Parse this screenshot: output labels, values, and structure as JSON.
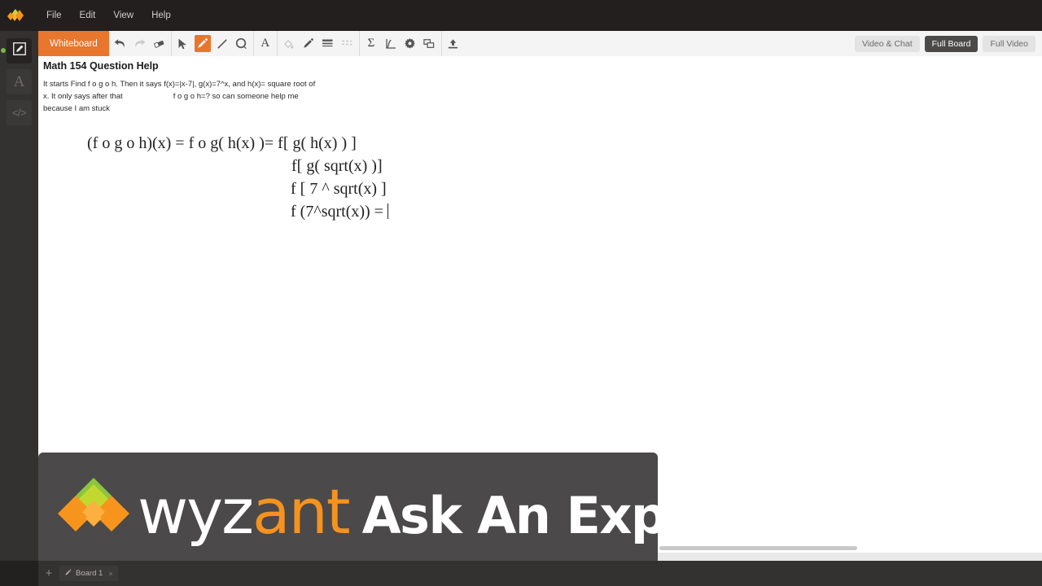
{
  "menubar": {
    "logo_icon": "wyzant-diamond-logo",
    "items": [
      {
        "label": "File"
      },
      {
        "label": "Edit"
      },
      {
        "label": "View"
      },
      {
        "label": "Help"
      }
    ]
  },
  "rail": {
    "items": [
      {
        "name": "whiteboard",
        "icon": "pencil-square-icon",
        "state": "active",
        "has_status_dot": true,
        "dot_color": "#7ab648"
      },
      {
        "name": "text",
        "icon": "letter-a-icon",
        "glyph": "A",
        "state": "idle"
      },
      {
        "name": "code",
        "icon": "code-brackets-icon",
        "glyph": "</>",
        "state": "idle"
      }
    ]
  },
  "toolbar": {
    "whiteboard_label": "Whiteboard",
    "accent_color": "#e8762c",
    "groups": [
      {
        "name": "history",
        "tools": [
          {
            "name": "undo",
            "icon": "undo-arrow-icon",
            "state": "enabled"
          },
          {
            "name": "redo",
            "icon": "redo-arrow-icon",
            "state": "disabled"
          },
          {
            "name": "eraser",
            "icon": "eraser-icon",
            "state": "enabled"
          }
        ]
      },
      {
        "name": "draw",
        "tools": [
          {
            "name": "select",
            "icon": "cursor-arrow-icon",
            "state": "enabled"
          },
          {
            "name": "pencil",
            "icon": "pencil-icon",
            "state": "selected"
          },
          {
            "name": "line",
            "icon": "line-icon",
            "state": "enabled"
          },
          {
            "name": "shape",
            "icon": "ellipse-icon",
            "state": "enabled"
          }
        ]
      },
      {
        "name": "text",
        "tools": [
          {
            "name": "text",
            "icon": "letter-a-icon",
            "glyph": "A",
            "state": "enabled"
          }
        ]
      },
      {
        "name": "style",
        "tools": [
          {
            "name": "fill-color",
            "icon": "paint-bucket-icon",
            "state": "disabled"
          },
          {
            "name": "stroke-color",
            "icon": "pen-color-icon",
            "state": "enabled"
          },
          {
            "name": "line-weight",
            "icon": "line-weight-icon",
            "state": "enabled"
          },
          {
            "name": "line-style",
            "icon": "dashed-line-icon",
            "state": "disabled"
          }
        ]
      },
      {
        "name": "insert",
        "tools": [
          {
            "name": "equation",
            "icon": "sigma-icon",
            "glyph": "Σ",
            "state": "enabled"
          },
          {
            "name": "graph",
            "icon": "graph-axes-icon",
            "state": "enabled"
          },
          {
            "name": "settings",
            "icon": "gear-icon",
            "state": "enabled"
          },
          {
            "name": "arrange",
            "icon": "layers-icon",
            "state": "enabled"
          }
        ]
      },
      {
        "name": "share",
        "tools": [
          {
            "name": "upload",
            "icon": "upload-icon",
            "state": "enabled"
          }
        ]
      }
    ],
    "view_buttons": [
      {
        "label": "Video & Chat",
        "state": "inactive"
      },
      {
        "label": "Full Board",
        "state": "active"
      },
      {
        "label": "Full Video",
        "state": "inactive"
      }
    ]
  },
  "canvas": {
    "question_title": "Math 154 Question Help",
    "question_body_line1": "It starts Find f o g o h. Then it says f(x)=|x-7|, g(x)=7^x, and h(x)= square root of",
    "question_body_line2a": "x. It only says after that",
    "question_body_line2b": "f o g o h=?  so can someone help me because I",
    "question_body_line3": "am stuck",
    "work_lines": [
      "(f o g o h)(x) = f o g( h(x) )= f[ g( h(x) ) ]",
      "f[ g( sqrt(x) )]",
      "f [ 7 ^ sqrt(x) ]",
      "f (7^sqrt(x)) = "
    ],
    "scrollbar": {
      "orientation": "horizontal"
    }
  },
  "watermark": {
    "logo_icon": "wyzant-diamond-logo",
    "brand_part1": "wyz",
    "brand_part2": "ant",
    "tagline": "Ask An Expert",
    "brand_color": "#f6921e"
  },
  "tabbar": {
    "add_label": "+",
    "tabs": [
      {
        "icon": "pencil-icon",
        "label": "Board 1",
        "close_label": "×"
      }
    ]
  }
}
